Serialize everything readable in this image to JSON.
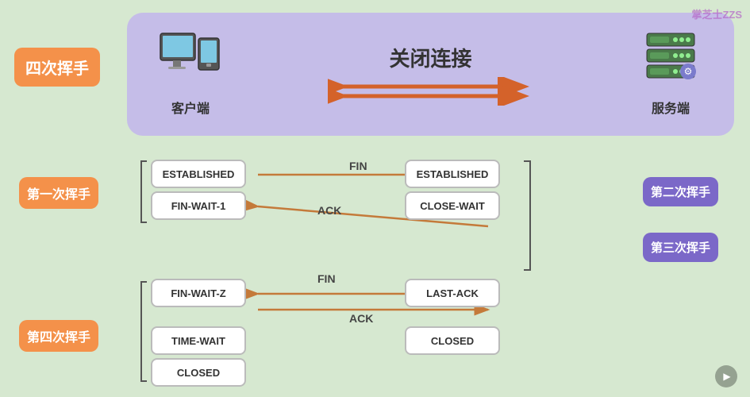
{
  "watermark": "掌芝士ZZS",
  "top": {
    "title": "关闭连接",
    "label": "四次挥手",
    "client": "客户端",
    "server": "服务端"
  },
  "handshakes": {
    "first": "第一次挥手",
    "second": "第二次挥手",
    "third": "第三次挥手",
    "fourth": "第四次挥手"
  },
  "states": {
    "established_left": "ESTABLISHED",
    "established_right": "ESTABLISHED",
    "fin_wait_1": "FIN-WAIT-1",
    "close_wait": "CLOSE-WAIT",
    "fin_wait_2": "FIN-WAIT-Z",
    "last_ack": "LAST-ACK",
    "time_wait": "TIME-WAIT",
    "closed_left": "CLOSED",
    "closed_right": "CLOSED"
  },
  "packets": {
    "fin1": "FIN",
    "ack1": "ACK",
    "fin2": "FIN",
    "ack2": "ACK"
  }
}
